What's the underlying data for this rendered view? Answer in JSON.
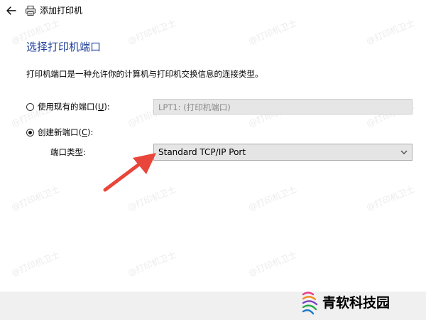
{
  "window": {
    "title": "添加打印机"
  },
  "page": {
    "heading": "选择打印机端口",
    "description": "打印机端口是一种允许你的计算机与打印机交换信息的连接类型。"
  },
  "options": {
    "existing": {
      "label_prefix": "使用现有的端口(",
      "mnemonic": "U",
      "label_suffix": "):",
      "selected": false,
      "select_value": "LPT1: (打印机端口)"
    },
    "create": {
      "label_prefix": "创建新端口(",
      "mnemonic": "C",
      "label_suffix": "):",
      "selected": true,
      "port_type_label": "端口类型:",
      "port_type_value": "Standard TCP/IP Port"
    }
  },
  "watermark": "@打印机卫士",
  "branding": {
    "text": "青软科技园"
  },
  "colors": {
    "heading": "#1e3f9a",
    "arrow": "#e8463b",
    "footer": "#f0f0f0"
  }
}
